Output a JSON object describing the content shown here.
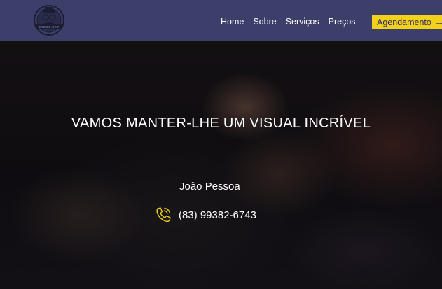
{
  "navbar": {
    "logo_text": "BARBER SHOP",
    "links": [
      {
        "label": "Home"
      },
      {
        "label": "Sobre"
      },
      {
        "label": "Serviços"
      },
      {
        "label": "Preços"
      }
    ],
    "cta_label": "Agendamento",
    "cta_arrow": "→"
  },
  "hero": {
    "headline": "VAMOS MANTER-LHE UM VISUAL INCRÍVEL",
    "city": "João Pessoa",
    "phone": "(83) 99382-6743"
  },
  "colors": {
    "navbar_bg": "#3b3f69",
    "cta_bg": "#f2d11b",
    "cta_text": "#2f2c6a",
    "phone_icon": "#f2d11b"
  },
  "icons": {
    "logo": "barber-shop-logo",
    "phone": "phone-icon",
    "arrow": "arrow-right-icon"
  }
}
